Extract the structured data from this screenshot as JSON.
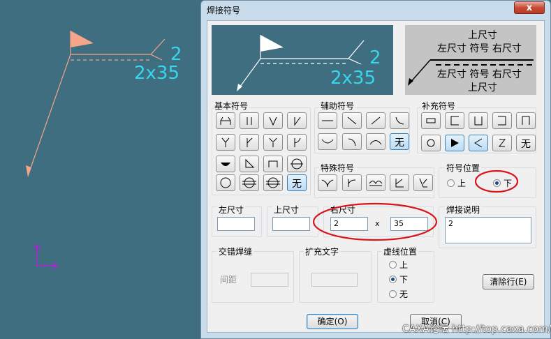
{
  "drawing": {
    "dimension_label": "2x35",
    "superscript": "2"
  },
  "dialog": {
    "title": "焊接符号",
    "close_label": "x"
  },
  "preview": {
    "dimension_label": "2x35",
    "superscript": "2"
  },
  "legend": {
    "top_line1": "上尺寸",
    "top_line2": "左尺寸 符号 右尺寸",
    "bottom_line1": "左尺寸 符号 右尺寸",
    "bottom_line2": "上尺寸"
  },
  "groups": {
    "basic": "基本符号",
    "auxiliary": "辅助符号",
    "supplementary": "补充符号",
    "special": "特殊符号",
    "position": "符号位置",
    "left_size": "左尺寸",
    "top_size": "上尺寸",
    "right_size": "右尺寸",
    "weld_note": "焊接说明",
    "staggered": "交错焊缝",
    "extra_text": "扩充文字",
    "dashed_position": "虚线位置"
  },
  "none_label": "无",
  "position_options": {
    "up": "上",
    "down": "下"
  },
  "dashed_options": {
    "up": "上",
    "down": "下",
    "none": "无"
  },
  "fields": {
    "left_size": "",
    "top_size": "",
    "right_size_a": "2",
    "times": "x",
    "right_size_b": "35",
    "weld_note": "2",
    "spacing_label": "间距",
    "spacing": "",
    "extra_text": ""
  },
  "buttons": {
    "clear": "清除行(E)",
    "ok": "确定(O)",
    "cancel": "取消(C)"
  },
  "watermark": "CAXA论坛 http://top.caxa.com/",
  "colors": {
    "canvas_bg": "#3e6e80",
    "leader_line": "#f4a58a",
    "dimension_text": "#37d6ec",
    "annotation_red": "#d9141a",
    "axis_purple": "#b020d6"
  }
}
